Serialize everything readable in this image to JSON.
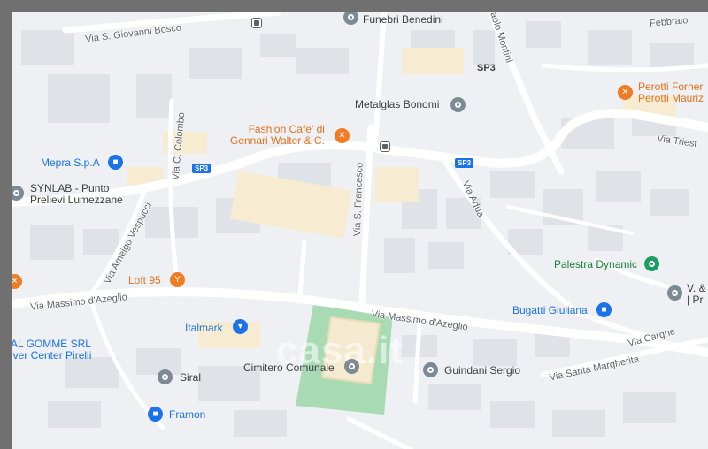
{
  "map": {
    "watermark": "casa.it",
    "roads": {
      "via_massimo_azeglio_w": "Via Massimo d'Azeglio",
      "via_massimo_azeglio_e": "Via Massimo d'Azeglio",
      "via_s_giovanni_bosco": "Via S. Giovanni Bosco",
      "via_s_francesco": "Via S. Francesco",
      "via_ameigo_vespucci": "Via Ameigo Vespucci",
      "via_c_colombo": "Via C. Colombo",
      "via_adua": "Via Adua",
      "via_cargne": "Via Cargne",
      "via_santa_margherita": "Via Santa Margherita",
      "via_trieste": "Via Triest",
      "via_febbraio": "Febbraio",
      "via_montini": "aolo Montini",
      "sp3_a": "SP3",
      "sp3_b": "SP3",
      "sp3_c": "SP3"
    },
    "pois": {
      "funebri": "Funebri Benedini",
      "metalglas": "Metalglas Bonomi",
      "fashion_cafe": "Fashion Cafe' di\nGennari Walter & C.",
      "mepra": "Mepra S.p.A",
      "synlab": "SYNLAB - Punto\nPrelievi Lumezzane",
      "loft95": "Loft 95",
      "italmark": "Italmark",
      "al_gomme": "AL GOMME SRL\niver Center Pirelli",
      "siral": "Siral",
      "framon": "Framon",
      "cimitero": "Cimitero Comunale",
      "guindani": "Guindani Sergio",
      "bugatti": "Bugatti Giuliana",
      "palestra": "Palestra Dynamic",
      "perotti": "Perotti Forner\nPerotti Mauriz",
      "v_and": "V. &\n| Pr"
    },
    "colors": {
      "background": "#eef0f3",
      "road": "#ffffff",
      "road_edge": "#c8cdd3",
      "building": "#dfe3e8",
      "commercial": "#f7ecd2",
      "cemetery": "#a8dbb4",
      "orange_poi": "#f07d24",
      "blue_poi": "#1a73e8",
      "green_poi": "#1e9e63",
      "gray_poi": "#7b8a94"
    }
  }
}
